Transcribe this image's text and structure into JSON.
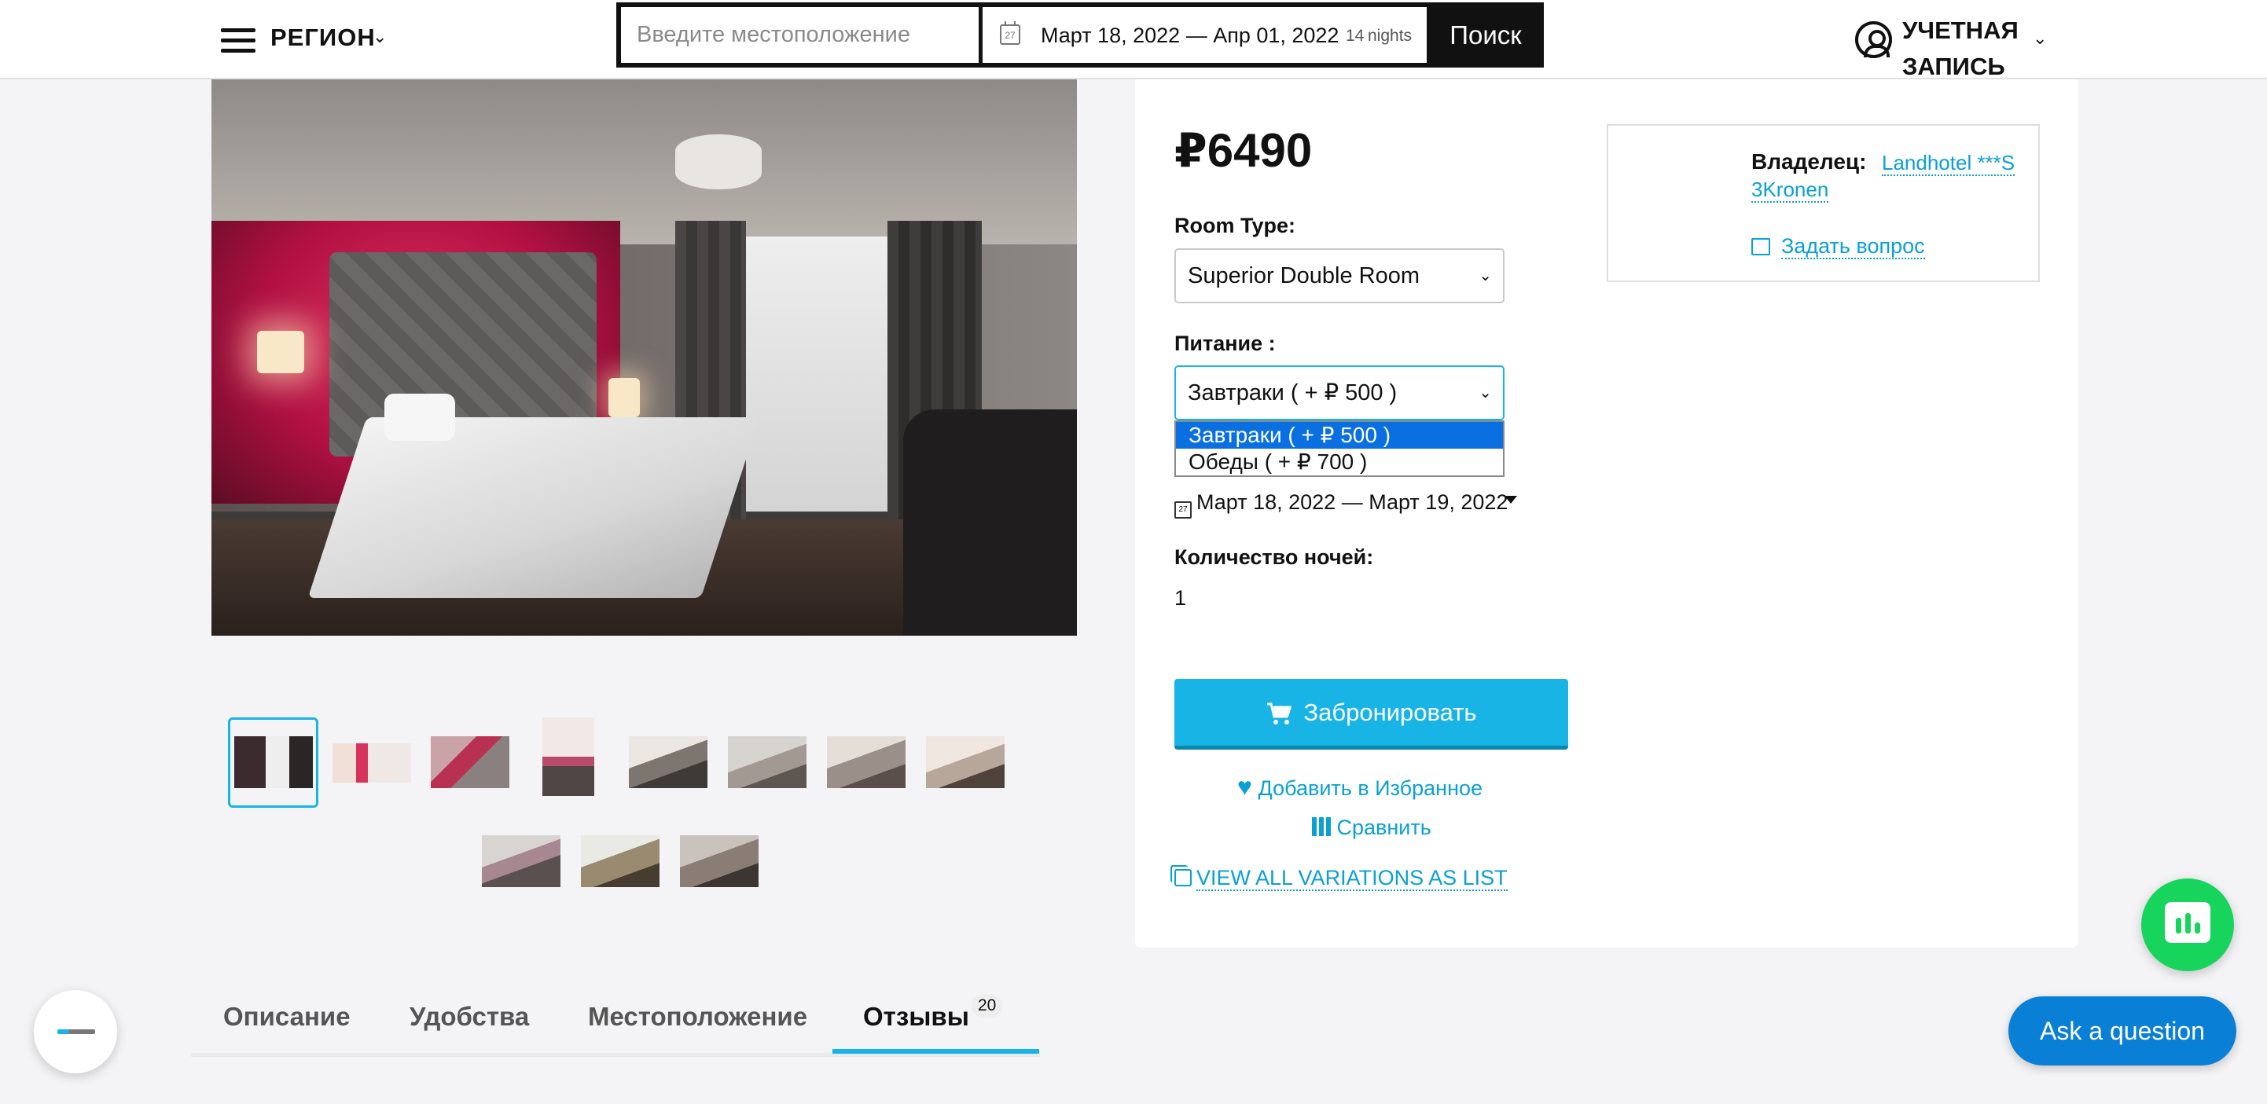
{
  "header": {
    "region": "РЕГИОН",
    "search_placeholder": "Введите местоположение",
    "date_range": "Март 18, 2022 — Апр 01, 2022",
    "nights_count": "14",
    "nights_label": "nights",
    "search_button": "Поиск",
    "account_label": "УЧЕТНАЯ ЗАПИСЬ"
  },
  "gallery": {
    "thumbnail_count": 11,
    "selected_thumbnail": 1
  },
  "booking": {
    "price": "₽6490",
    "room_type_label": "Room Type:",
    "room_type_value": "Superior Double Room",
    "meal_label": "Питание :",
    "meal_value": "Завтраки ( + ₽ 500 )",
    "meal_options": [
      "Завтраки ( + ₽ 500 )",
      "Обеды ( + ₽ 700 )"
    ],
    "date_range": "Март 18, 2022 — Март 19, 2022",
    "nights_label": "Количество ночей:",
    "nights_value": "1",
    "book_button": "Забронировать",
    "favorite_link": "Добавить в Избранное",
    "compare_link": "Сравнить",
    "variations_link": "VIEW ALL VARIATIONS AS LIST"
  },
  "owner": {
    "label": "Владелец:",
    "name": "Landhotel ***S 3Kronen",
    "ask_link": "Задать вопрос"
  },
  "tabs": {
    "items": [
      "Описание",
      "Удобства",
      "Местоположение",
      "Отзывы"
    ],
    "reviews_count": "20",
    "active": "Отзывы"
  },
  "floating": {
    "ask_question": "Ask a question"
  },
  "colors": {
    "accent": "#18b4e6",
    "chat_green": "#17d45c",
    "ask_blue": "#0a7fd6",
    "option_highlight": "#0a6fe0"
  }
}
